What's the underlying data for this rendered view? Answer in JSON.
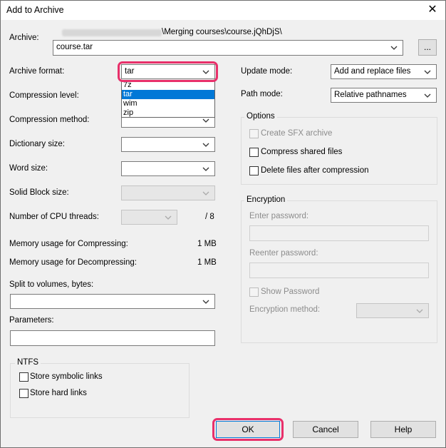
{
  "window": {
    "title": "Add to Archive"
  },
  "archive": {
    "label": "Archive:",
    "path_suffix": "\\Merging courses\\course.jQhDjS\\",
    "value": "course.tar",
    "browse_label": "..."
  },
  "left": {
    "archive_format_label": "Archive format:",
    "archive_format_value": "tar",
    "format_options": [
      "7z",
      "tar",
      "wim",
      "zip"
    ],
    "compression_level_label": "Compression level:",
    "compression_method_label": "Compression method:",
    "dictionary_size_label": "Dictionary size:",
    "word_size_label": "Word size:",
    "solid_block_label": "Solid Block size:",
    "cpu_threads_label": "Number of CPU threads:",
    "cpu_threads_total": "/ 8",
    "mem_compress_label": "Memory usage for Compressing:",
    "mem_compress_value": "1 MB",
    "mem_decompress_label": "Memory usage for Decompressing:",
    "mem_decompress_value": "1 MB",
    "split_label": "Split to volumes, bytes:",
    "parameters_label": "Parameters:"
  },
  "ntfs": {
    "title": "NTFS",
    "symlinks_label": "Store symbolic links",
    "hardlinks_label": "Store hard links"
  },
  "right": {
    "update_mode_label": "Update mode:",
    "update_mode_value": "Add and replace files",
    "path_mode_label": "Path mode:",
    "path_mode_value": "Relative pathnames"
  },
  "options": {
    "title": "Options",
    "sfx_label": "Create SFX archive",
    "compress_shared_label": "Compress shared files",
    "delete_after_label": "Delete files after compression"
  },
  "encryption": {
    "title": "Encryption",
    "enter_password_label": "Enter password:",
    "reenter_password_label": "Reenter password:",
    "show_password_label": "Show Password",
    "method_label": "Encryption method:"
  },
  "buttons": {
    "ok": "OK",
    "cancel": "Cancel",
    "help": "Help"
  },
  "colors": {
    "highlight": "#e8306a",
    "selection": "#0078d7"
  }
}
